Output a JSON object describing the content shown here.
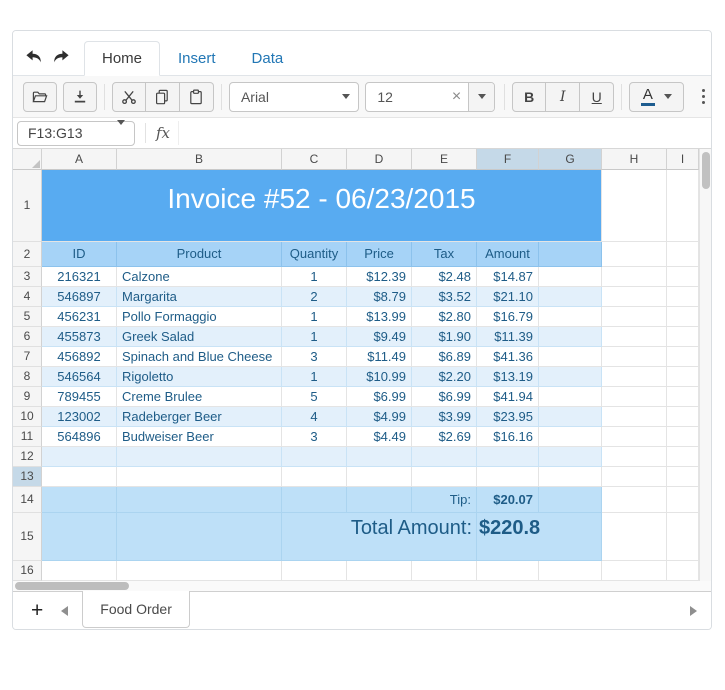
{
  "tabs": {
    "items": [
      {
        "label": "Home",
        "active": true
      },
      {
        "label": "Insert",
        "active": false
      },
      {
        "label": "Data",
        "active": false
      }
    ]
  },
  "toolbar": {
    "font_name": "Arial",
    "font_size": "12",
    "bold_label": "B",
    "italic_label": "I",
    "underline_label": "U",
    "color_letter": "A"
  },
  "formula_bar": {
    "name_box_value": "F13:G13",
    "fx_label": "fx",
    "formula_value": ""
  },
  "grid": {
    "column_headers": [
      "A",
      "B",
      "C",
      "D",
      "E",
      "F",
      "G",
      "H",
      "I"
    ],
    "row_numbers": [
      "1",
      "2",
      "3",
      "4",
      "5",
      "6",
      "7",
      "8",
      "9",
      "10",
      "11",
      "12",
      "13",
      "14",
      "15",
      "16"
    ],
    "selected_columns": [
      "F",
      "G"
    ],
    "selected_row": "13",
    "title": "Invoice #52 - 06/23/2015",
    "table_headers": [
      "ID",
      "Product",
      "Quantity",
      "Price",
      "Tax",
      "Amount"
    ],
    "rows": [
      [
        "216321",
        "Calzone",
        "1",
        "$12.39",
        "$2.48",
        "$14.87"
      ],
      [
        "546897",
        "Margarita",
        "2",
        "$8.79",
        "$3.52",
        "$21.10"
      ],
      [
        "456231",
        "Pollo Formaggio",
        "1",
        "$13.99",
        "$2.80",
        "$16.79"
      ],
      [
        "455873",
        "Greek Salad",
        "1",
        "$9.49",
        "$1.90",
        "$11.39"
      ],
      [
        "456892",
        "Spinach and Blue Cheese",
        "3",
        "$11.49",
        "$6.89",
        "$41.36"
      ],
      [
        "546564",
        "Rigoletto",
        "1",
        "$10.99",
        "$2.20",
        "$13.19"
      ],
      [
        "789455",
        "Creme Brulee",
        "5",
        "$6.99",
        "$6.99",
        "$41.94"
      ],
      [
        "123002",
        "Radeberger Beer",
        "4",
        "$4.99",
        "$3.99",
        "$23.95"
      ],
      [
        "564896",
        "Budweiser Beer",
        "3",
        "$4.49",
        "$2.69",
        "$16.16"
      ]
    ],
    "tip_label": "Tip:",
    "tip_value": "$20.07",
    "total_label": "Total Amount:",
    "total_value": "$220.8"
  },
  "sheet_bar": {
    "add_button": "+",
    "active_sheet": "Food Order"
  },
  "colors": {
    "title_bg": "#58abf1",
    "title_text": "#ffffff",
    "table_header_bg": "#a6d3f7",
    "band_bg": "#e3f0fb",
    "summary_bg": "#bee0f8",
    "cell_text": "#1e5c87",
    "selected_header_bg": "#c5d9e8",
    "link_color": "#2277b5",
    "accent_underline": "#1d5c8f"
  }
}
